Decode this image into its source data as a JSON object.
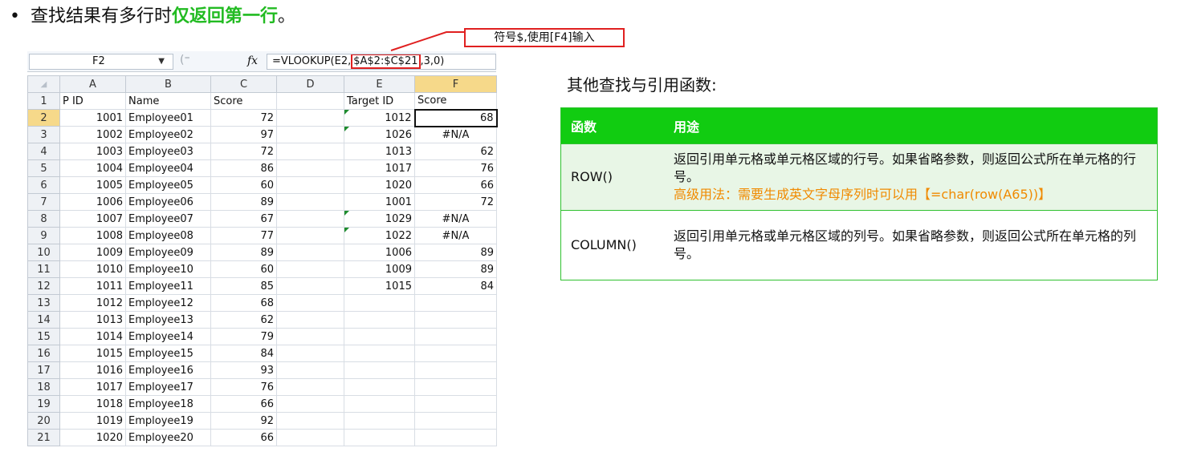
{
  "heading": {
    "bullet": "•",
    "prefix": "查找结果有多行时",
    "highlight": "仅返回第一行",
    "suffix": "。"
  },
  "callout": {
    "text": "符号$,使用[F4]输入"
  },
  "formula_bar": {
    "cell_ref": "F2",
    "fx": "fx",
    "formula_pre": "=VLOOKUP(E2,",
    "formula_range": "$A$2:$C$21",
    "formula_post": ",3,0)"
  },
  "grid": {
    "columns": [
      "A",
      "B",
      "C",
      "D",
      "E",
      "F"
    ],
    "header_row": {
      "num": "1",
      "cells": [
        "P ID",
        "Name",
        "Score",
        "",
        "Target ID",
        "Score"
      ]
    },
    "rows": [
      [
        "2",
        "1001",
        "Employee01",
        "72",
        "",
        "1012",
        "68"
      ],
      [
        "3",
        "1002",
        "Employee02",
        "97",
        "",
        "1026",
        "#N/A"
      ],
      [
        "4",
        "1003",
        "Employee03",
        "72",
        "",
        "1013",
        "62"
      ],
      [
        "5",
        "1004",
        "Employee04",
        "86",
        "",
        "1017",
        "76"
      ],
      [
        "6",
        "1005",
        "Employee05",
        "60",
        "",
        "1020",
        "66"
      ],
      [
        "7",
        "1006",
        "Employee06",
        "89",
        "",
        "1001",
        "72"
      ],
      [
        "8",
        "1007",
        "Employee07",
        "67",
        "",
        "1029",
        "#N/A"
      ],
      [
        "9",
        "1008",
        "Employee08",
        "77",
        "",
        "1022",
        "#N/A"
      ],
      [
        "10",
        "1009",
        "Employee09",
        "89",
        "",
        "1006",
        "89"
      ],
      [
        "11",
        "1010",
        "Employee10",
        "60",
        "",
        "1009",
        "89"
      ],
      [
        "12",
        "1011",
        "Employee11",
        "85",
        "",
        "1015",
        "84"
      ],
      [
        "13",
        "1012",
        "Employee12",
        "68",
        "",
        "",
        ""
      ],
      [
        "14",
        "1013",
        "Employee13",
        "62",
        "",
        "",
        ""
      ],
      [
        "15",
        "1014",
        "Employee14",
        "79",
        "",
        "",
        ""
      ],
      [
        "16",
        "1015",
        "Employee15",
        "84",
        "",
        "",
        ""
      ],
      [
        "17",
        "1016",
        "Employee16",
        "93",
        "",
        "",
        ""
      ],
      [
        "18",
        "1017",
        "Employee17",
        "76",
        "",
        "",
        ""
      ],
      [
        "19",
        "1018",
        "Employee18",
        "66",
        "",
        "",
        ""
      ],
      [
        "20",
        "1019",
        "Employee19",
        "92",
        "",
        "",
        ""
      ],
      [
        "21",
        "1020",
        "Employee20",
        "66",
        "",
        "",
        ""
      ]
    ]
  },
  "side": {
    "title": "其他查找与引用函数:",
    "table_headers": [
      "函数",
      "用途"
    ],
    "rows": [
      {
        "name": "ROW()",
        "desc": "返回引用单元格或单元格区域的行号。如果省略参数，则返回公式所在单元格的行号。",
        "note": "高级用法：需要生成英文字母序列时可以用【=char(row(A65))】"
      },
      {
        "name": "COLUMN()",
        "desc": "返回引用单元格或单元格区域的列号。如果省略参数，则返回公式所在单元格的列号。"
      }
    ]
  },
  "colors": {
    "highlight_green": "#22bb22",
    "header_green": "#11cc11",
    "callout_red": "#e02020",
    "note_orange": "#f08a00"
  }
}
